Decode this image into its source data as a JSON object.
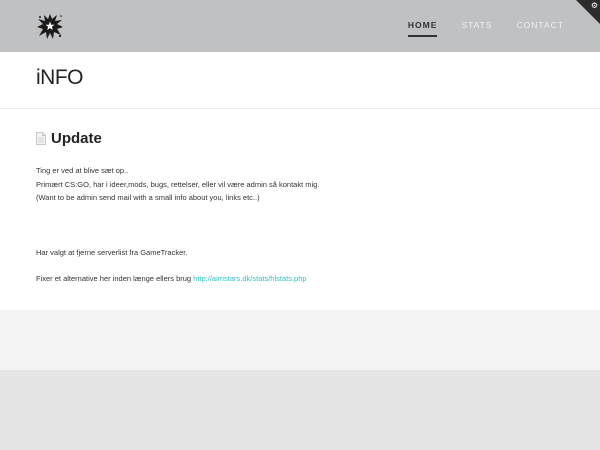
{
  "header": {
    "logo_icon": "splat-star-logo",
    "nav": [
      {
        "label": "HOME",
        "active": true
      },
      {
        "label": "STATS",
        "active": false
      },
      {
        "label": "CONTACT",
        "active": false
      }
    ],
    "corner_icon": "gear-icon"
  },
  "page": {
    "title": "iNFO"
  },
  "post": {
    "icon": "document-icon",
    "title": "Update",
    "lines": [
      "Ting er ved at blive sæt op..",
      "Primært CS:GO, har i ideer,mods, bugs, rettelser, eller vil være admin så kontakt mig.",
      "(Want to be admin send mail with a small info about you, links etc..)"
    ],
    "paragraph2": "Har valgt at fjerne serverlist fra GameTracker.",
    "paragraph3_text": "Fixer et alternative her inden længe ellers brug ",
    "paragraph3_link": "http://aimstars.dk/stats/hlstats.php"
  },
  "colors": {
    "header_bg": "#c0c1c3",
    "link": "#2ec4c4",
    "corner": "#2c2c2c"
  }
}
